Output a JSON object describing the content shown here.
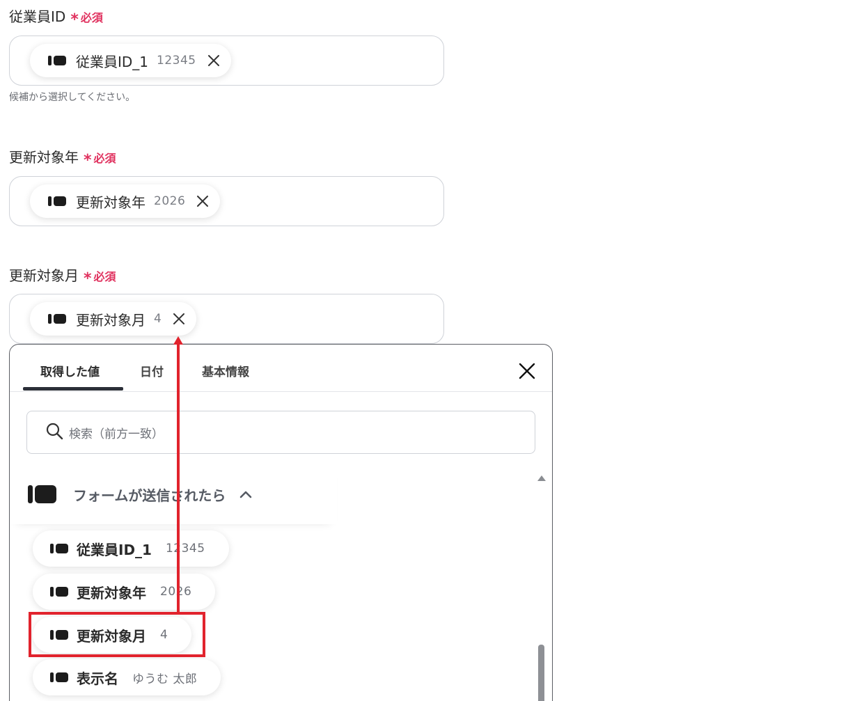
{
  "fields": [
    {
      "label": "従業員ID",
      "required_label": "必須",
      "chip": {
        "name": "従業員ID_1",
        "value": "12345"
      },
      "hint": "候補から選択してください。"
    },
    {
      "label": "更新対象年",
      "required_label": "必須",
      "chip": {
        "name": "更新対象年",
        "value": "2026"
      }
    },
    {
      "label": "更新対象月",
      "required_label": "必須",
      "chip": {
        "name": "更新対象月",
        "value": "4"
      }
    }
  ],
  "required_marker": "*",
  "popup": {
    "tabs": [
      {
        "label": "取得した値",
        "active": true
      },
      {
        "label": "日付",
        "active": false
      },
      {
        "label": "基本情報",
        "active": false
      }
    ],
    "search_placeholder": "検索（前方一致）",
    "group": {
      "title": "フォームが送信されたら",
      "expanded": true,
      "items": [
        {
          "name": "従業員ID_1",
          "value": "12345"
        },
        {
          "name": "更新対象年",
          "value": "2026"
        },
        {
          "name": "更新対象月",
          "value": "4",
          "highlighted": true
        },
        {
          "name": "表示名",
          "value": "ゆうむ 太郎"
        }
      ]
    }
  },
  "colors": {
    "required": "#e0325f",
    "annotation": "#e1232d",
    "text": "#2b2b2b"
  }
}
